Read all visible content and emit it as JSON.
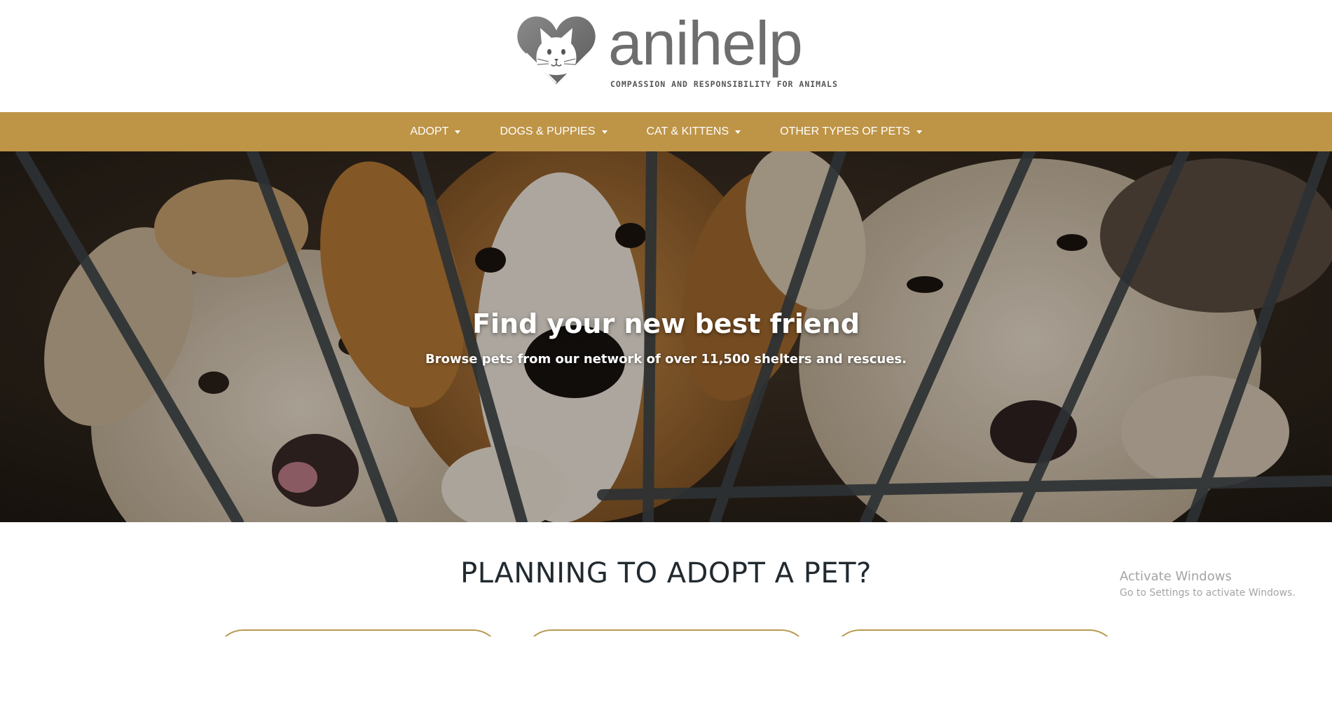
{
  "brand": {
    "name": "anihelp",
    "tagline": "COMPASSION AND RESPONSIBILITY FOR ANIMALS",
    "logo_icon": "cat-in-heart-icon",
    "colors": {
      "nav_background": "#be9447",
      "logo_gray": "#6e6e6e",
      "card_border": "#b59a4f",
      "heading_text": "#222a30"
    }
  },
  "nav": {
    "items": [
      {
        "label": "ADOPT",
        "icon": "caret-down-icon"
      },
      {
        "label": "DOGS & PUPPIES",
        "icon": "caret-down-icon"
      },
      {
        "label": "CAT & KITTENS",
        "icon": "caret-down-icon"
      },
      {
        "label": "OTHER TYPES OF PETS",
        "icon": "caret-down-icon"
      }
    ]
  },
  "hero": {
    "title": "Find your new best friend",
    "subtitle": "Browse pets from our network of over 11,500 shelters and rescues.",
    "image_subject": "puppies behind cage bars"
  },
  "planning": {
    "heading": "PLANNING TO ADOPT A PET?"
  },
  "watermark": {
    "title": "Activate Windows",
    "subtitle": "Go to Settings to activate Windows."
  }
}
